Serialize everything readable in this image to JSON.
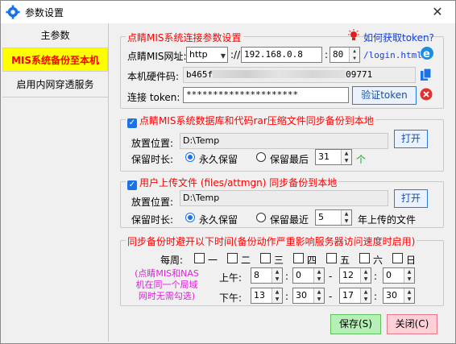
{
  "window": {
    "title": "参数设置",
    "close": "✕"
  },
  "nav": {
    "items": [
      "主参数",
      "MIS系统备份至本机",
      "启用内网穿透服务"
    ]
  },
  "conn": {
    "legend": "点睛MIS系统连接参数设置",
    "help_link": "如何获取token?",
    "url_label": "点睛MIS网址:",
    "protocol": "http",
    "sep_slashes": "://",
    "host": "192.168.0.8",
    "colon": ":",
    "port": "80",
    "path": "/login.html",
    "hw_label": "本机硬件码:",
    "hw_prefix": "b465f",
    "hw_suffix": "09771",
    "token_label": "连接 token:",
    "token_value": "*********************",
    "verify_btn": "验证token"
  },
  "db": {
    "legend": "点睛MIS系统数据库和代码rar压缩文件同步备份到本地",
    "path_label": "放置位置:",
    "path_value": "D:\\Temp",
    "open_btn": "打开",
    "keep_label": "保留时长:",
    "opt_forever": "永久保留",
    "opt_last": "保留最后",
    "last_value": "31",
    "unit": "个"
  },
  "files": {
    "legend": "用户上传文件 (files/attmgn) 同步备份到本地",
    "path_label": "放置位置:",
    "path_value": "D:\\Temp",
    "open_btn": "打开",
    "keep_label": "保留时长:",
    "opt_forever": "永久保留",
    "opt_recent": "保留最近",
    "recent_value": "5",
    "unit": "年上传的文件"
  },
  "schedule": {
    "legend": "同步备份时避开以下时间(备份动作严重影响服务器访问速度时启用)",
    "note": "(点睛MIS和NAS机在同一个局域网时无需勾选)",
    "week_label": "每周:",
    "days": [
      "一",
      "二",
      "三",
      "四",
      "五",
      "六",
      "日"
    ],
    "am_label": "上午:",
    "pm_label": "下午:",
    "am": {
      "h1": "8",
      "m1": "0",
      "h2": "12",
      "m2": "0"
    },
    "pm": {
      "h1": "13",
      "m1": "30",
      "h2": "17",
      "m2": "30"
    },
    "colon": ":",
    "dash": "-"
  },
  "actions": {
    "save": "保存(S)",
    "close": "关闭(C)"
  },
  "colors": {
    "accent": "#1a73e8",
    "legend_red": "#ff0000",
    "nav_active_bg": "#ffff00",
    "pink_note": "#e020e0"
  }
}
